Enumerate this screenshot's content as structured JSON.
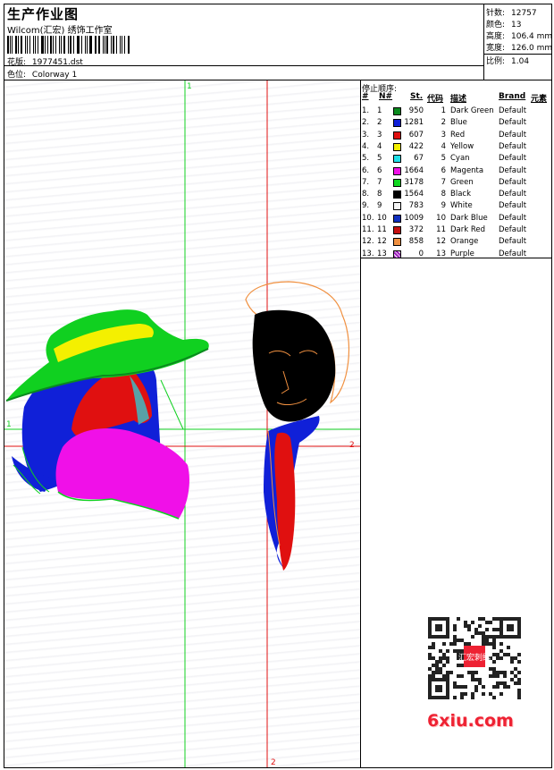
{
  "header": {
    "title": "生产作业图",
    "company": "Wilcom(汇宏) 绣饰工作室",
    "file_label": "花版:",
    "file_value": "1977451.dst",
    "colorway_label": "色位:",
    "colorway_value": "Colorway 1"
  },
  "stats": {
    "stitches_label": "针数:",
    "stitches_value": "12757",
    "colors_label": "颜色:",
    "colors_value": "13",
    "height_label": "高度:",
    "height_value": "106.4 mm",
    "width_label": "宽度:",
    "width_value": "126.0 mm",
    "scale_label": "比例:",
    "scale_value": "1.04"
  },
  "stop_sequence": {
    "title": "停止顺序:",
    "headers": {
      "hash": "#",
      "no": "N#",
      "st": "St.",
      "code": "代码",
      "desc": "描述",
      "brand": "Brand",
      "element": "元素"
    },
    "rows": [
      {
        "idx": "1.",
        "no": "1",
        "st": "950",
        "code": "1",
        "desc": "Dark Green",
        "brand": "Default",
        "color": "#0a8a1e"
      },
      {
        "idx": "2.",
        "no": "2",
        "st": "1281",
        "code": "2",
        "desc": "Blue",
        "brand": "Default",
        "color": "#1020d8"
      },
      {
        "idx": "3.",
        "no": "3",
        "st": "607",
        "code": "3",
        "desc": "Red",
        "brand": "Default",
        "color": "#e01010"
      },
      {
        "idx": "4.",
        "no": "4",
        "st": "422",
        "code": "4",
        "desc": "Yellow",
        "brand": "Default",
        "color": "#f4f000"
      },
      {
        "idx": "5.",
        "no": "5",
        "st": "67",
        "code": "5",
        "desc": "Cyan",
        "brand": "Default",
        "color": "#20e0e8"
      },
      {
        "idx": "6.",
        "no": "6",
        "st": "1664",
        "code": "6",
        "desc": "Magenta",
        "brand": "Default",
        "color": "#f010e8"
      },
      {
        "idx": "7.",
        "no": "7",
        "st": "3178",
        "code": "7",
        "desc": "Green",
        "brand": "Default",
        "color": "#10d820"
      },
      {
        "idx": "8.",
        "no": "8",
        "st": "1564",
        "code": "8",
        "desc": "Black",
        "brand": "Default",
        "color": "#000000"
      },
      {
        "idx": "9.",
        "no": "9",
        "st": "783",
        "code": "9",
        "desc": "White",
        "brand": "Default",
        "color": "#f4f4f4"
      },
      {
        "idx": "10.",
        "no": "10",
        "st": "1009",
        "code": "10",
        "desc": "Dark Blue",
        "brand": "Default",
        "color": "#1030c0"
      },
      {
        "idx": "11.",
        "no": "11",
        "st": "372",
        "code": "11",
        "desc": "Dark Red",
        "brand": "Default",
        "color": "#c41010"
      },
      {
        "idx": "12.",
        "no": "12",
        "st": "858",
        "code": "12",
        "desc": "Orange",
        "brand": "Default",
        "color": "#f09040"
      },
      {
        "idx": "13.",
        "no": "13",
        "st": "0",
        "code": "13",
        "desc": "Purple",
        "brand": "Default",
        "color": "#a020c0"
      }
    ]
  },
  "axes": {
    "green_top": "1",
    "green_left": "1",
    "red_right": "2",
    "red_bottom": "2"
  },
  "watermark": {
    "brand": "6xiu.com",
    "seal": "汇宏刺绣"
  }
}
